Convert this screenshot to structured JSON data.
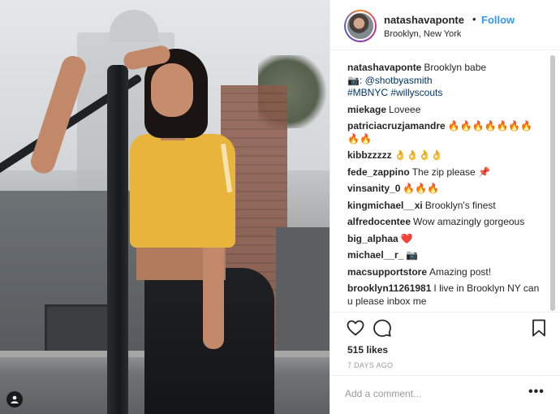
{
  "header": {
    "username": "natashavaponte",
    "separator": "•",
    "follow_label": "Follow",
    "location": "Brooklyn, New York"
  },
  "comments": [
    {
      "user": "natashavaponte",
      "text": "Brooklyn babe"
    },
    {
      "user": "",
      "text": "📷: @shotbyasmith"
    },
    {
      "user": "",
      "text": "#MBNYC #willyscouts"
    },
    {
      "user": "miekage",
      "text": "Loveee"
    },
    {
      "user": "patriciacruzjamandre",
      "text": "🔥🔥🔥🔥🔥🔥🔥🔥🔥"
    },
    {
      "user": "kibbzzzzz",
      "text": "👌👌👌👌"
    },
    {
      "user": "fede_zappino",
      "text": "The zip please 📌"
    },
    {
      "user": "vinsanity_0",
      "text": "🔥🔥🔥"
    },
    {
      "user": "kingmichael__xi",
      "text": "Brooklyn's finest"
    },
    {
      "user": "alfredocentee",
      "text": "Wow amazingly gorgeous"
    },
    {
      "user": "big_alphaa",
      "text": "❤️"
    },
    {
      "user": "michael__r_",
      "text": "📷"
    },
    {
      "user": "macsupportstore",
      "text": "Amazing post!"
    },
    {
      "user": "brooklyn11261981",
      "text": "I live in Brooklyn NY can u please inbox me"
    }
  ],
  "actions": {
    "likes": "515 likes",
    "timestamp": "7 DAYS AGO"
  },
  "add_comment": {
    "placeholder": "Add a comment...",
    "more_label": "•••"
  },
  "colors": {
    "accent": "#3897f0",
    "text": "#262626",
    "muted": "#999999"
  }
}
